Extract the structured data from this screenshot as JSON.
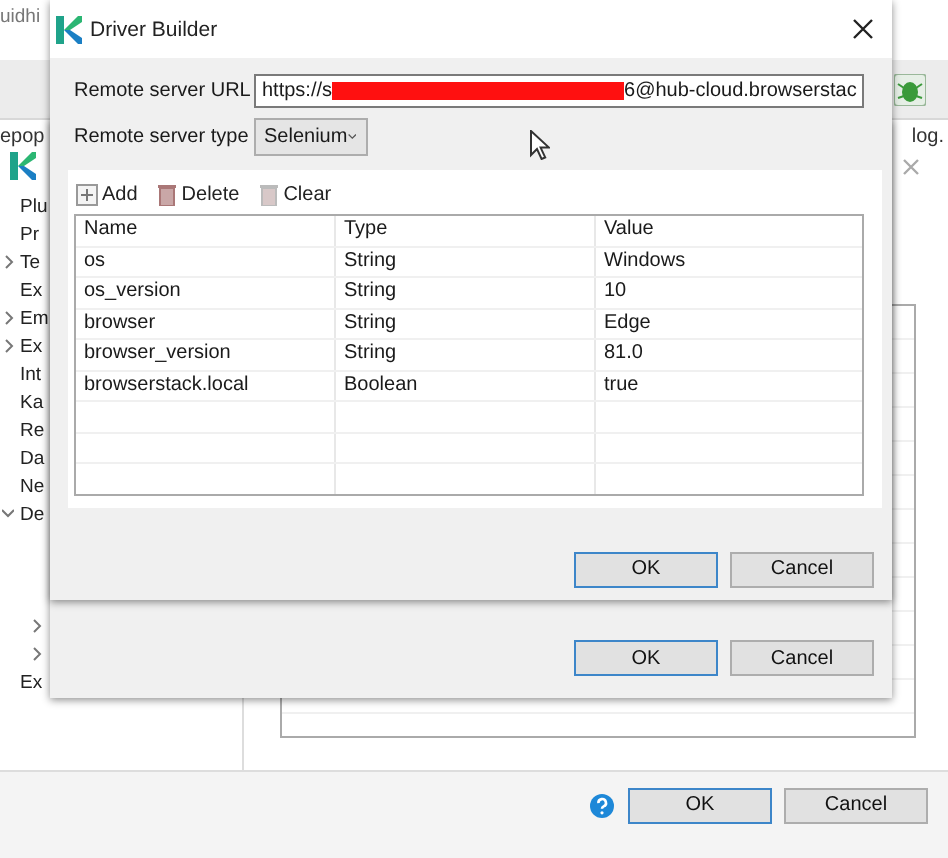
{
  "background_window": {
    "title_fragment": "uidhi",
    "tabs": [
      {
        "label": "epop"
      },
      {
        "label": "log."
      }
    ],
    "tree": [
      {
        "label": "Plu",
        "kind": "leaf"
      },
      {
        "label": "Pr",
        "kind": "leaf"
      },
      {
        "label": "Te",
        "kind": "branch",
        "expanded": false
      },
      {
        "label": "Ex",
        "kind": "leaf"
      },
      {
        "label": "Em",
        "kind": "branch",
        "expanded": false
      },
      {
        "label": "Ex",
        "kind": "branch",
        "expanded": false
      },
      {
        "label": "Int",
        "kind": "leaf"
      },
      {
        "label": "Ka",
        "kind": "leaf"
      },
      {
        "label": "Re",
        "kind": "leaf"
      },
      {
        "label": "Da",
        "kind": "leaf"
      },
      {
        "label": "Ne",
        "kind": "leaf"
      },
      {
        "label": "De",
        "kind": "branch",
        "expanded": true,
        "children": [
          {
            "kind": "branch",
            "expanded": false
          },
          {
            "kind": "branch",
            "expanded": false
          }
        ]
      },
      {
        "label": "Ex",
        "kind": "leaf"
      }
    ],
    "buttons": [
      {
        "label": "OK",
        "default": true
      },
      {
        "label": "Cancel",
        "default": false
      }
    ]
  },
  "back_dialog": {
    "buttons": [
      {
        "label": "OK",
        "default": true
      },
      {
        "label": "Cancel",
        "default": false
      }
    ]
  },
  "dialog": {
    "title": "Driver Builder",
    "url": {
      "label": "Remote server URL",
      "value_start": "https://s",
      "value_end": "6@hub-cloud.browserstac",
      "redacted": true
    },
    "server_type": {
      "label": "Remote server type",
      "value": "Selenium"
    },
    "toolbar": [
      {
        "kind": "add",
        "label": "Add"
      },
      {
        "kind": "delete",
        "label": "Delete"
      },
      {
        "kind": "clear",
        "label": "Clear"
      }
    ],
    "table": {
      "columns": [
        "Name",
        "Type",
        "Value"
      ],
      "rows": [
        [
          "os",
          "String",
          "Windows"
        ],
        [
          "os_version",
          "String",
          "10"
        ],
        [
          "browser",
          "String",
          "Edge"
        ],
        [
          "browser_version",
          "String",
          "81.0"
        ],
        [
          "browserstack.local",
          "Boolean",
          "true"
        ]
      ]
    },
    "buttons": [
      {
        "label": "OK",
        "default": true
      },
      {
        "label": "Cancel",
        "default": false
      }
    ]
  }
}
